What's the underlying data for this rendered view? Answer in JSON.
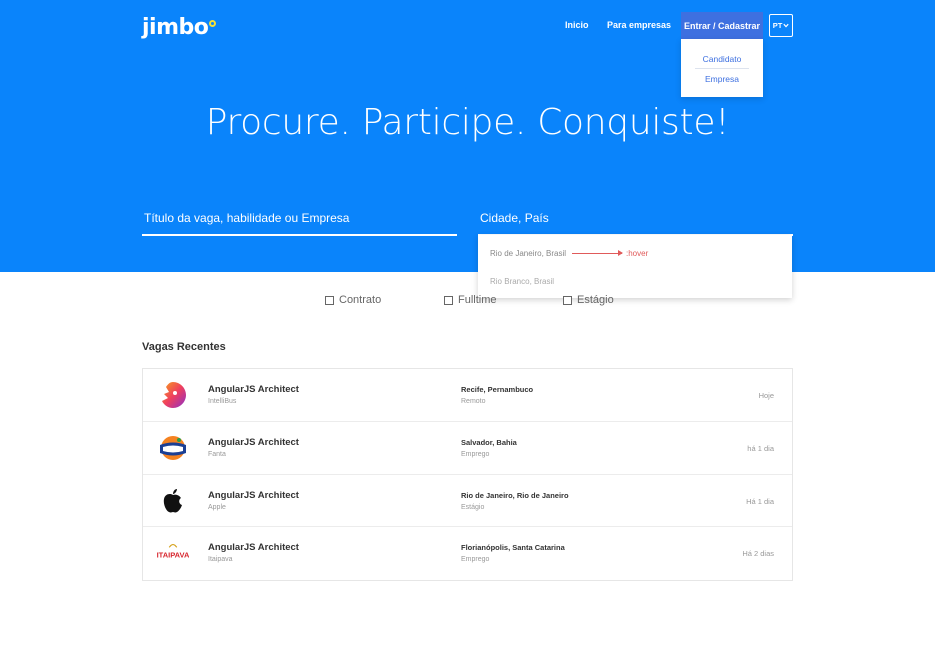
{
  "header": {
    "logo_text": "jimbo",
    "nav": {
      "inicio": "Inicio",
      "empresas": "Para empresas",
      "login": "Entrar / Cadastrar",
      "lang": "PT"
    },
    "login_menu": [
      "Candidato",
      "Empresa"
    ]
  },
  "hero": {
    "headline": "Procure. Participe. Conquiste!",
    "job_search_placeholder": "Título da vaga, habilidade ou Empresa",
    "city_search_placeholder": "Cidade, País",
    "city_suggestions": [
      "Rio de Janeiro, Brasil",
      "Rio Branco, Brasil"
    ],
    "hover_annotation": ":hover"
  },
  "filters": [
    "Contrato",
    "Fulltime",
    "Estágio"
  ],
  "recent_jobs": {
    "title": "Vagas Recentes",
    "items": [
      {
        "title": "AngularJS Architect",
        "company": "IntelliBus",
        "location": "Recife, Pernambuco",
        "type": "Remoto",
        "date": "Hoje",
        "logo": "lion-logo-icon"
      },
      {
        "title": "AngularJS Architect",
        "company": "Fanta",
        "location": "Salvador, Bahia",
        "type": "Emprego",
        "date": "há 1 dia",
        "logo": "fanta-logo-icon"
      },
      {
        "title": "AngularJS Architect",
        "company": "Apple",
        "location": "Rio de Janeiro, Rio de Janeiro",
        "type": "Estágio",
        "date": "Há 1 dia",
        "logo": "apple-logo-icon"
      },
      {
        "title": "AngularJS Architect",
        "company": "Itaipava",
        "location": "Florianópolis, Santa Catarina",
        "type": "Emprego",
        "date": "Há 2 dias",
        "logo": "itaipava-logo-icon",
        "logo_text": "ITAIPAVA"
      }
    ]
  },
  "colors": {
    "hero_blue": "#0a84fb",
    "button_blue": "#3e70e0",
    "logo_accent": "#f5e13a",
    "hover_red": "#e05a5a"
  }
}
